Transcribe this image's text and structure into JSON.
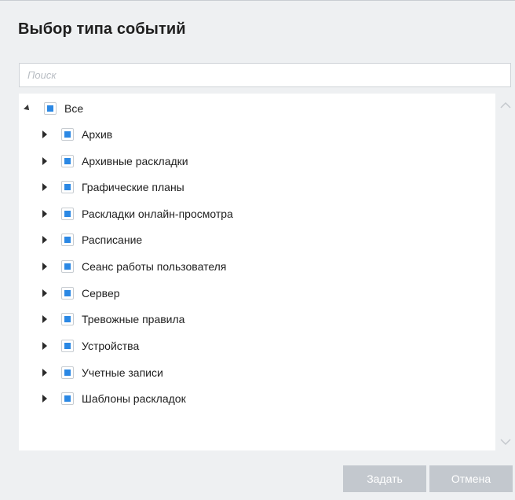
{
  "dialog": {
    "title": "Выбор типа событий",
    "search_placeholder": "Поиск",
    "root": {
      "label": "Все",
      "expanded": true,
      "checked": "partial"
    },
    "items": [
      {
        "label": "Архив"
      },
      {
        "label": "Архивные раскладки"
      },
      {
        "label": "Графические планы"
      },
      {
        "label": "Раскладки онлайн-просмотра"
      },
      {
        "label": "Расписание"
      },
      {
        "label": "Сеанс работы пользователя"
      },
      {
        "label": "Сервер"
      },
      {
        "label": "Тревожные правила"
      },
      {
        "label": "Устройства"
      },
      {
        "label": "Учетные записи"
      },
      {
        "label": "Шаблоны раскладок"
      }
    ],
    "buttons": {
      "set": "Задать",
      "cancel": "Отмена"
    },
    "colors": {
      "checkbox_fill": "#2b88e4",
      "button_disabled": "#c3c8ce",
      "background": "#eef0f2"
    }
  }
}
